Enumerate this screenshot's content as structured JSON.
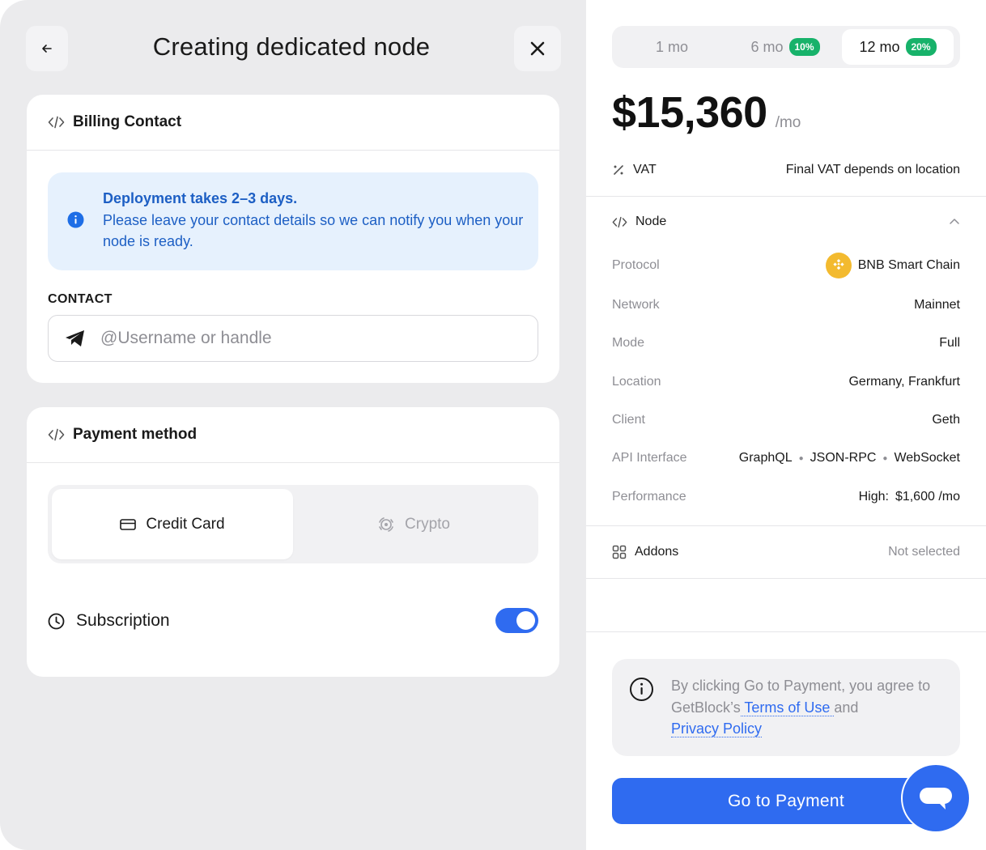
{
  "header": {
    "title": "Creating dedicated node"
  },
  "billing": {
    "title": "Billing Contact",
    "info_title": "Deployment takes 2–3 days.",
    "info_body": "Please leave your contact details so we can notify you when your node is ready.",
    "contact_label": "CONTACT",
    "contact_placeholder": "@Username or handle",
    "contact_value": ""
  },
  "payment": {
    "title": "Payment method",
    "options": [
      {
        "label": "Credit Card",
        "selected": true
      },
      {
        "label": "Crypto",
        "selected": false
      }
    ],
    "subscription_label": "Subscription",
    "subscription_on": true
  },
  "plan": {
    "tabs": [
      {
        "label": "1 mo",
        "badge": "",
        "selected": false
      },
      {
        "label": "6 mo",
        "badge": "10%",
        "selected": false
      },
      {
        "label": "12 mo",
        "badge": "20%",
        "selected": true
      }
    ],
    "price": "$15,360",
    "price_unit": "/mo",
    "vat_label": "VAT",
    "vat_value": "Final VAT depends on location"
  },
  "node": {
    "title": "Node",
    "rows": [
      {
        "label": "Protocol",
        "value": "BNB Smart Chain"
      },
      {
        "label": "Network",
        "value": "Mainnet"
      },
      {
        "label": "Mode",
        "value": "Full"
      },
      {
        "label": "Location",
        "value": "Germany, Frankfurt"
      },
      {
        "label": "Client",
        "value": "Geth"
      },
      {
        "label": "API Interface",
        "values": [
          "GraphQL",
          "JSON-RPC",
          "WebSocket"
        ]
      },
      {
        "label": "Performance",
        "level": "High:",
        "value": "$1,600 /mo"
      }
    ]
  },
  "addons": {
    "title": "Addons",
    "value": "Not selected"
  },
  "terms": {
    "text_before": "By clicking Go to Payment, you agree to GetBlock’s",
    "terms_link": " Terms of Use ",
    "text_mid": "and",
    "privacy_link": "Privacy Policy"
  },
  "cta": {
    "label": "Go to Payment"
  },
  "colors": {
    "accent": "#2f6bf0",
    "badge": "#17b26a",
    "info_bg": "#e6f1fd",
    "info_text": "#1d5fc4"
  }
}
